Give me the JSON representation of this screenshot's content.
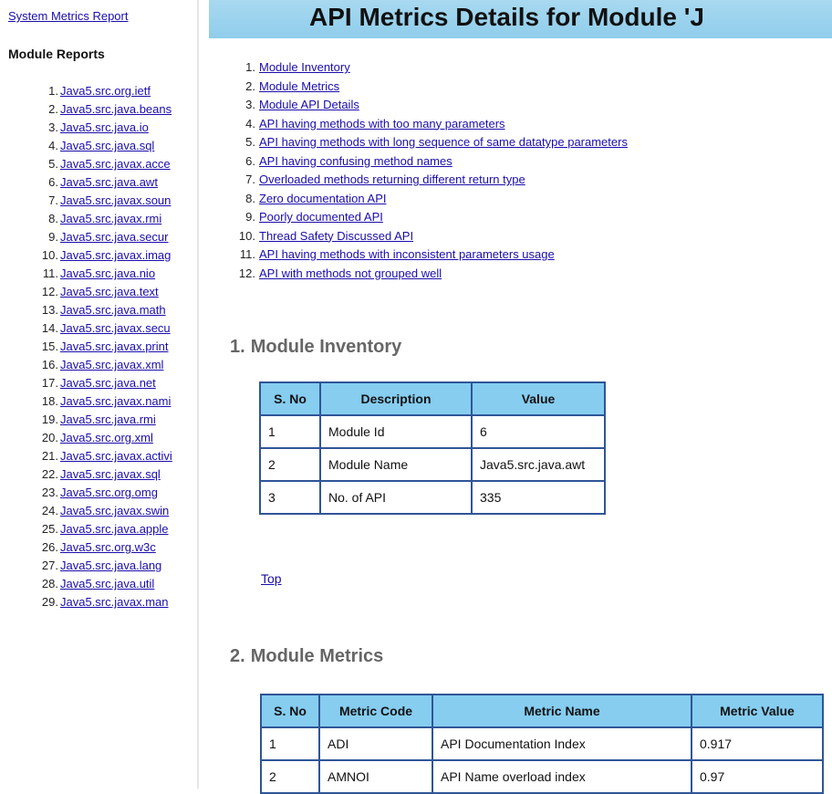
{
  "sidebar": {
    "system_link": "System Metrics Report",
    "heading": "Module Reports",
    "items": [
      {
        "num": "1.",
        "label": "Java5.src.org.ietf"
      },
      {
        "num": "2.",
        "label": "Java5.src.java.beans"
      },
      {
        "num": "3.",
        "label": "Java5.src.java.io"
      },
      {
        "num": "4.",
        "label": "Java5.src.java.sql"
      },
      {
        "num": "5.",
        "label": "Java5.src.javax.acce"
      },
      {
        "num": "6.",
        "label": "Java5.src.java.awt"
      },
      {
        "num": "7.",
        "label": "Java5.src.javax.soun"
      },
      {
        "num": "8.",
        "label": "Java5.src.javax.rmi"
      },
      {
        "num": "9.",
        "label": "Java5.src.java.secur"
      },
      {
        "num": "10.",
        "label": "Java5.src.javax.imag"
      },
      {
        "num": "11.",
        "label": "Java5.src.java.nio"
      },
      {
        "num": "12.",
        "label": "Java5.src.java.text"
      },
      {
        "num": "13.",
        "label": "Java5.src.java.math"
      },
      {
        "num": "14.",
        "label": "Java5.src.javax.secu"
      },
      {
        "num": "15.",
        "label": "Java5.src.javax.print"
      },
      {
        "num": "16.",
        "label": "Java5.src.javax.xml"
      },
      {
        "num": "17.",
        "label": "Java5.src.java.net"
      },
      {
        "num": "18.",
        "label": "Java5.src.javax.nami"
      },
      {
        "num": "19.",
        "label": "Java5.src.java.rmi"
      },
      {
        "num": "20.",
        "label": "Java5.src.org.xml"
      },
      {
        "num": "21.",
        "label": "Java5.src.javax.activi"
      },
      {
        "num": "22.",
        "label": "Java5.src.javax.sql"
      },
      {
        "num": "23.",
        "label": "Java5.src.org.omg"
      },
      {
        "num": "24.",
        "label": "Java5.src.javax.swin"
      },
      {
        "num": "25.",
        "label": "Java5.src.java.apple"
      },
      {
        "num": "26.",
        "label": "Java5.src.org.w3c"
      },
      {
        "num": "27.",
        "label": "Java5.src.java.lang"
      },
      {
        "num": "28.",
        "label": "Java5.src.java.util"
      },
      {
        "num": "29.",
        "label": "Java5.src.javax.man"
      }
    ]
  },
  "main": {
    "title": "API Metrics Details for Module 'J",
    "toc": [
      {
        "num": "1.",
        "label": "Module Inventory"
      },
      {
        "num": "2.",
        "label": "Module Metrics"
      },
      {
        "num": "3.",
        "label": "Module API Details"
      },
      {
        "num": "4.",
        "label": "API having methods with too many parameters"
      },
      {
        "num": "5.",
        "label": "API having methods with long sequence of same datatype parameters"
      },
      {
        "num": "6.",
        "label": "API having confusing method names"
      },
      {
        "num": "7.",
        "label": "Overloaded methods returning different return type"
      },
      {
        "num": "8.",
        "label": "Zero documentation API"
      },
      {
        "num": "9.",
        "label": "Poorly documented API"
      },
      {
        "num": "10.",
        "label": "Thread Safety Discussed API"
      },
      {
        "num": "11.",
        "label": "API having methods with inconsistent parameters usage"
      },
      {
        "num": "12.",
        "label": "API with methods not grouped well"
      }
    ],
    "inventory": {
      "section_num": "1.",
      "title": "Module Inventory",
      "headers": [
        "S. No",
        "Description",
        "Value"
      ],
      "rows": [
        [
          "1",
          "Module Id",
          "6"
        ],
        [
          "2",
          "Module Name",
          "Java5.src.java.awt"
        ],
        [
          "3",
          "No. of API",
          "335"
        ]
      ]
    },
    "top_link": "Top",
    "metrics": {
      "section_num": "2.",
      "title": "Module Metrics",
      "headers": [
        "S. No",
        "Metric Code",
        "Metric Name",
        "Metric Value"
      ],
      "rows": [
        [
          "1",
          "ADI",
          "API Documentation Index",
          "0.917"
        ],
        [
          "2",
          "AMNOI",
          "API Name overload index",
          "0.97"
        ]
      ]
    }
  },
  "colors": {
    "banner": "#8fcdeb",
    "table_header": "#86cdf0",
    "table_border": "#2f5597",
    "link": "#1a0dab",
    "section_title": "#666666"
  }
}
